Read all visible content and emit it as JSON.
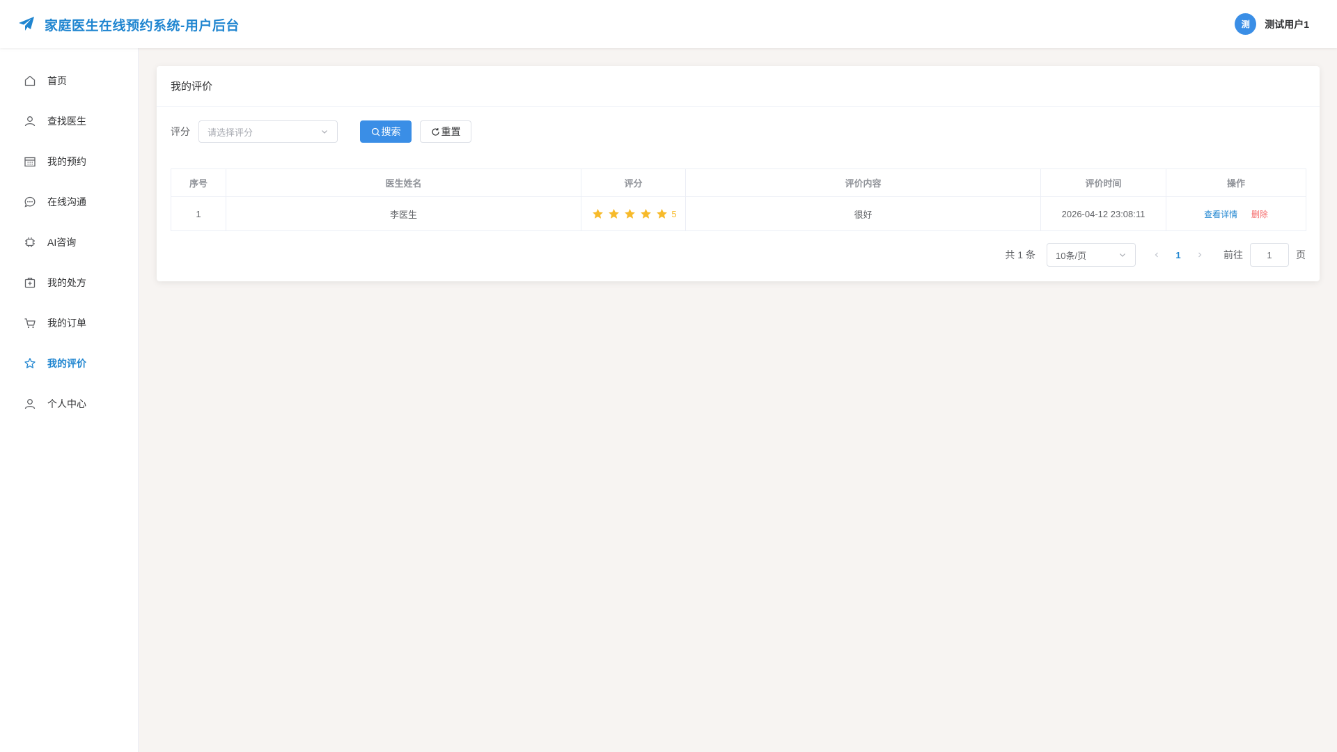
{
  "header": {
    "app_title": "家庭医生在线预约系统-用户后台",
    "avatar_text": "测",
    "user_name": "测试用户1"
  },
  "sidebar": {
    "items": [
      {
        "label": "首页",
        "icon": "home-icon"
      },
      {
        "label": "查找医生",
        "icon": "user-icon"
      },
      {
        "label": "我的预约",
        "icon": "calendar-icon"
      },
      {
        "label": "在线沟通",
        "icon": "chat-icon"
      },
      {
        "label": "AI咨询",
        "icon": "cpu-icon"
      },
      {
        "label": "我的处方",
        "icon": "medical-box-icon"
      },
      {
        "label": "我的订单",
        "icon": "cart-icon"
      },
      {
        "label": "我的评价",
        "icon": "star-icon"
      },
      {
        "label": "个人中心",
        "icon": "user-icon"
      }
    ],
    "active_index": 7
  },
  "main": {
    "title": "我的评价",
    "filter": {
      "label": "评分",
      "select_placeholder": "请选择评分",
      "search_label": "搜索",
      "reset_label": "重置"
    },
    "table": {
      "columns": [
        "序号",
        "医生姓名",
        "评分",
        "评价内容",
        "评价时间",
        "操作"
      ],
      "rows": [
        {
          "index": "1",
          "doctor": "李医生",
          "rating": 5,
          "rating_text": "5",
          "content": "很好",
          "time": "2026-04-12 23:08:11",
          "view_label": "查看详情",
          "delete_label": "删除"
        }
      ]
    },
    "pagination": {
      "total_text": "共 1 条",
      "page_size": "10条/页",
      "current_page": "1",
      "goto_label": "前往",
      "goto_value": "1",
      "page_unit": "页"
    }
  },
  "colors": {
    "accent": "#1f85d0",
    "primary_button": "#3a8ee6",
    "star": "#f7ba2a",
    "danger": "#f56c6c",
    "background": "#f7f4f2"
  }
}
